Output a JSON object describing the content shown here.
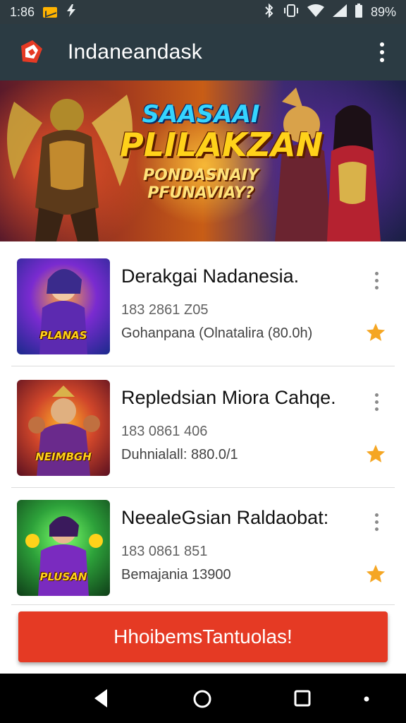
{
  "status_bar": {
    "time": "1:86",
    "battery": "89%",
    "icons": [
      "mail-icon",
      "flash-icon",
      "bluetooth-icon",
      "vibrate-icon",
      "wifi-icon",
      "signal-icon",
      "battery-icon"
    ]
  },
  "app_bar": {
    "title": "Indaneandask",
    "logo_icon": "app-logo-icon",
    "menu_icon": "more-vert-icon"
  },
  "banner": {
    "line1": "SAASAAI",
    "line2": "PLILAKZAN",
    "line3": "PONDASNAIY",
    "line4": "PFUNAVIAY?"
  },
  "list": [
    {
      "title": "Derakgai Nadanesia.",
      "meta": "183 2861 Z05",
      "subtitle": "Gohanpana (Olnatalira (80.0h)",
      "thumb_caption": "PLANAS",
      "colors": [
        "#1b2a8c",
        "#6d2bd0",
        "#e7891a"
      ]
    },
    {
      "title": "Repledsian Miora Cahqe.",
      "meta": "183 0861 406",
      "subtitle": "Duhnialall: 880.0/1",
      "thumb_caption": "NEIMBGH",
      "colors": [
        "#7a1d1d",
        "#d0462a",
        "#ffb02b"
      ]
    },
    {
      "title": "NeealeGsian Raldaobat:",
      "meta": "183 0861 851",
      "subtitle": "Bemajania 13900",
      "thumb_caption": "PLUSAN",
      "colors": [
        "#0f4d1d",
        "#2da13a",
        "#7a2bbf"
      ]
    }
  ],
  "cta": {
    "label": "HhoibemsTantuolas!"
  },
  "accent": {
    "app_bar": "#2b3b43",
    "cta": "#e53a24",
    "star": "#f5a623"
  }
}
